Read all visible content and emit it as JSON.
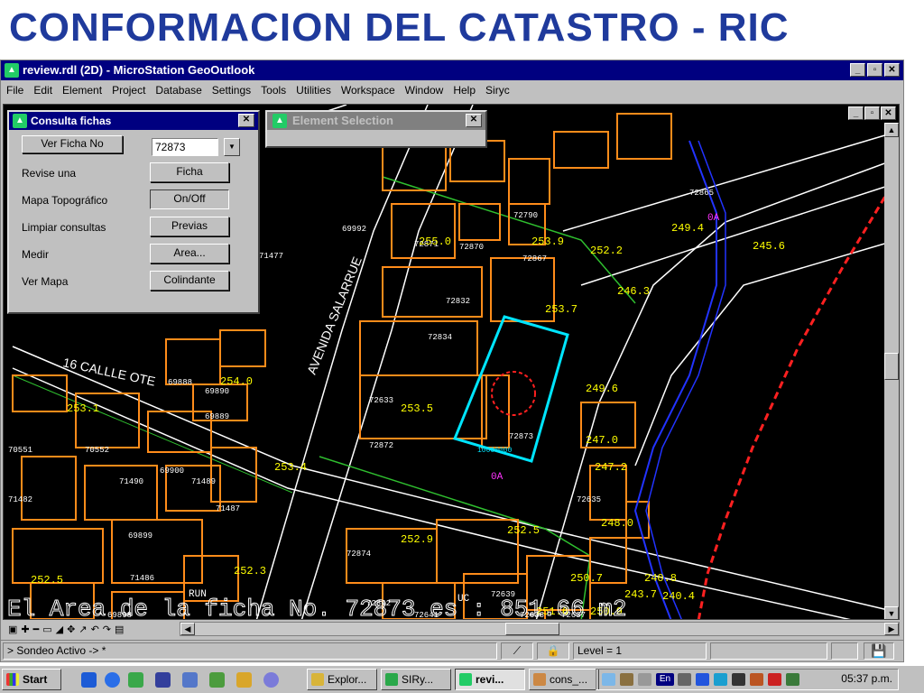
{
  "slide": {
    "title": "CONFORMACION DEL CATASTRO - RIC"
  },
  "window": {
    "title": "review.rdl (2D) - MicroStation GeoOutlook"
  },
  "menu": [
    "File",
    "Edit",
    "Element",
    "Project",
    "Database",
    "Settings",
    "Tools",
    "Utilities",
    "Workspace",
    "Window",
    "Help",
    "Siryc"
  ],
  "consulta": {
    "title": "Consulta fichas",
    "ver_ficha_button": "Ver Ficha No",
    "ficha_number": "72873",
    "rows": [
      {
        "label": "Revise una",
        "button": "Ficha"
      },
      {
        "label": "Mapa Topográfico",
        "button": "On/Off"
      },
      {
        "label": "Limpiar consultas",
        "button": "Previas"
      },
      {
        "label": "Medir",
        "button": "Area..."
      },
      {
        "label": "Ver Mapa",
        "button": "Colindante"
      }
    ]
  },
  "element_selection": {
    "title": "Element Selection"
  },
  "map": {
    "street_labels": [
      "AVENIDA SALARRUE",
      "16 CALLLE OTE"
    ],
    "parcel_numbers": [
      "72865",
      "72790",
      "72871",
      "72870",
      "72867",
      "72832",
      "72834",
      "72633",
      "72872",
      "72873",
      "72635",
      "72874",
      "72842",
      "72641",
      "72639",
      "72638",
      "72637",
      "71477",
      "69992",
      "69888",
      "69890",
      "69889",
      "70551",
      "70552",
      "71490",
      "69900",
      "71489",
      "71487",
      "69899",
      "71486",
      "69898",
      "71482"
    ],
    "elevations": [
      "249.4",
      "245.6",
      "253.9",
      "252.2",
      "255.0",
      "246.3",
      "253.7",
      "249.6",
      "253.5",
      "247.0",
      "247.2",
      "253.4",
      "254.0",
      "253.1",
      "248.0",
      "252.5",
      "252.9",
      "252.3",
      "250.7",
      "243.7",
      "240.8",
      "240.4",
      "250.9",
      "251.6",
      "252.5"
    ],
    "other_labels": [
      "0A",
      "0A",
      "UC",
      "RUN",
      "10000000"
    ],
    "bottom_text": "El Area de la ficha No. 72873 es : 851.66 m2",
    "colors": {
      "parcel": "#ff8c1a",
      "street": "#ffffff",
      "road": "#2fbf2f",
      "river": "#2233ff",
      "boundary": "#ff2020",
      "selected": "#00e5ff",
      "elev": "#ffff00",
      "label": "#ffffff",
      "oa": "#ff33ff"
    }
  },
  "status": {
    "prompt": "> Sondeo Activo -> *",
    "level": "Level = 1"
  },
  "taskbar": {
    "start": "Start",
    "apps": [
      {
        "label": "Explor...",
        "active": false
      },
      {
        "label": "SIRy...",
        "active": false
      },
      {
        "label": "revi...",
        "active": true
      },
      {
        "label": "cons_...",
        "active": false
      }
    ],
    "tray_lang": "En",
    "clock": "05:37 p.m."
  }
}
